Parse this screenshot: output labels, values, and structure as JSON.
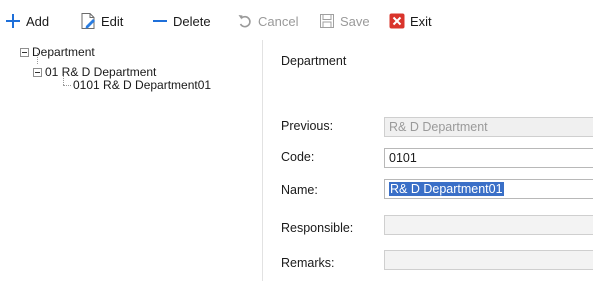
{
  "toolbar": {
    "add": "Add",
    "edit": "Edit",
    "delete": "Delete",
    "cancel": "Cancel",
    "save": "Save",
    "exit": "Exit"
  },
  "tree": {
    "root": "Department",
    "child": "01 R& D Department",
    "leaf": "0101 R& D Department01"
  },
  "form": {
    "title": "Department",
    "previous_label": "Previous:",
    "previous_value": "R& D Department",
    "code_label": "Code:",
    "code_value": "0101",
    "name_label": "Name:",
    "name_value": "R& D Department01",
    "responsible_label": "Responsible:",
    "responsible_value": "",
    "remarks_label": "Remarks:",
    "remarks_value": ""
  },
  "colors": {
    "add_icon": "#1e6fd9",
    "edit_icon": "#2a7de1",
    "delete_icon": "#1e6fd9",
    "exit_icon": "#d9342b",
    "selection": "#3a6fc7"
  }
}
